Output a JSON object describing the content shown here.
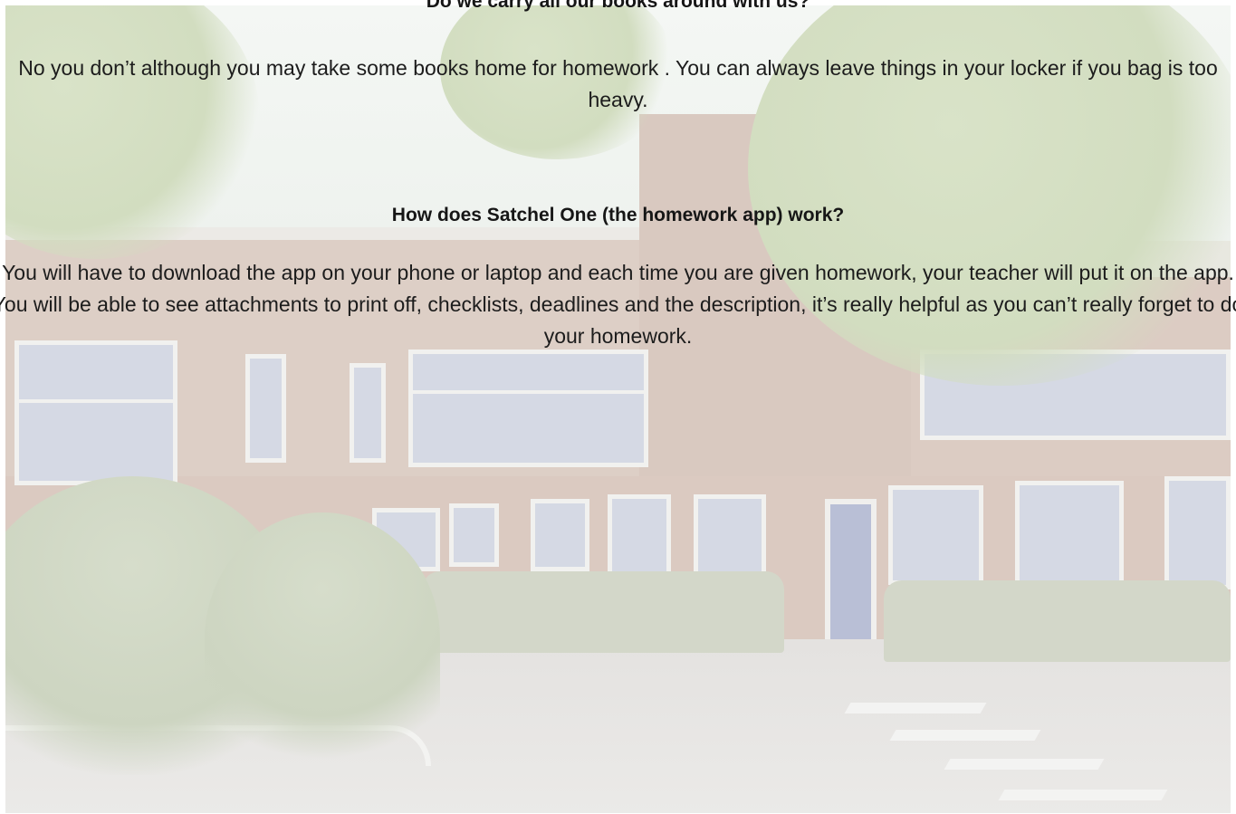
{
  "faq": [
    {
      "question": "Do we carry all our books around with us?",
      "answer": "No you don’t although you may take some books home for homework . You can always leave things in your locker if you bag is too heavy."
    },
    {
      "question": "How does Satchel One (the homework app)  work?",
      "answer": "You will have to download the app on your phone or laptop and each time you are given  homework, your teacher will put it on the app. You will be able to see attachments to print off, checklists, deadlines and the description, it’s really helpful as you can’t really forget to do your homework."
    }
  ],
  "colors": {
    "text": "#1c1c1c",
    "background": "#ffffff"
  }
}
